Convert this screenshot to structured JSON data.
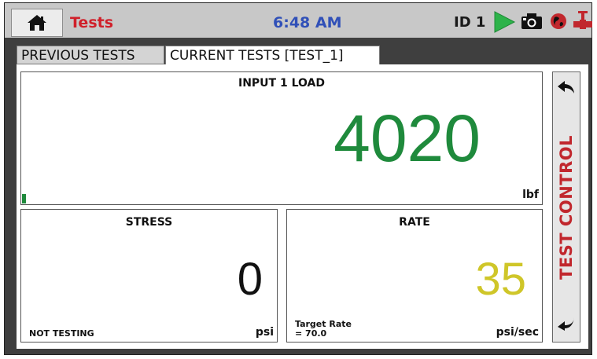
{
  "header": {
    "title": "Tests",
    "time": "6:48 AM",
    "id_label": "ID 1",
    "icons": [
      "home-icon",
      "play-icon",
      "camera-icon",
      "globe-icon",
      "valve-icon"
    ]
  },
  "tabs": [
    {
      "label": "PREVIOUS TESTS",
      "active": false
    },
    {
      "label": "CURRENT TESTS [TEST_1]",
      "active": true
    }
  ],
  "load_panel": {
    "title": "INPUT 1 LOAD",
    "value": "4020",
    "unit": "lbf",
    "value_color": "#1f8a3c"
  },
  "stress_panel": {
    "title": "STRESS",
    "value": "0",
    "unit": "psi",
    "status": "NOT TESTING"
  },
  "rate_panel": {
    "title": "RATE",
    "value": "35",
    "unit": "psi/sec",
    "target_line1": "Target Rate",
    "target_line2": "= 70.0",
    "value_color": "#cfc629"
  },
  "side_control": {
    "label": "TEST CONTROL",
    "label_color": "#c1272d"
  },
  "colors": {
    "accent_red": "#d0202a",
    "clock_blue": "#3050b8",
    "play_green": "#2db34a"
  }
}
